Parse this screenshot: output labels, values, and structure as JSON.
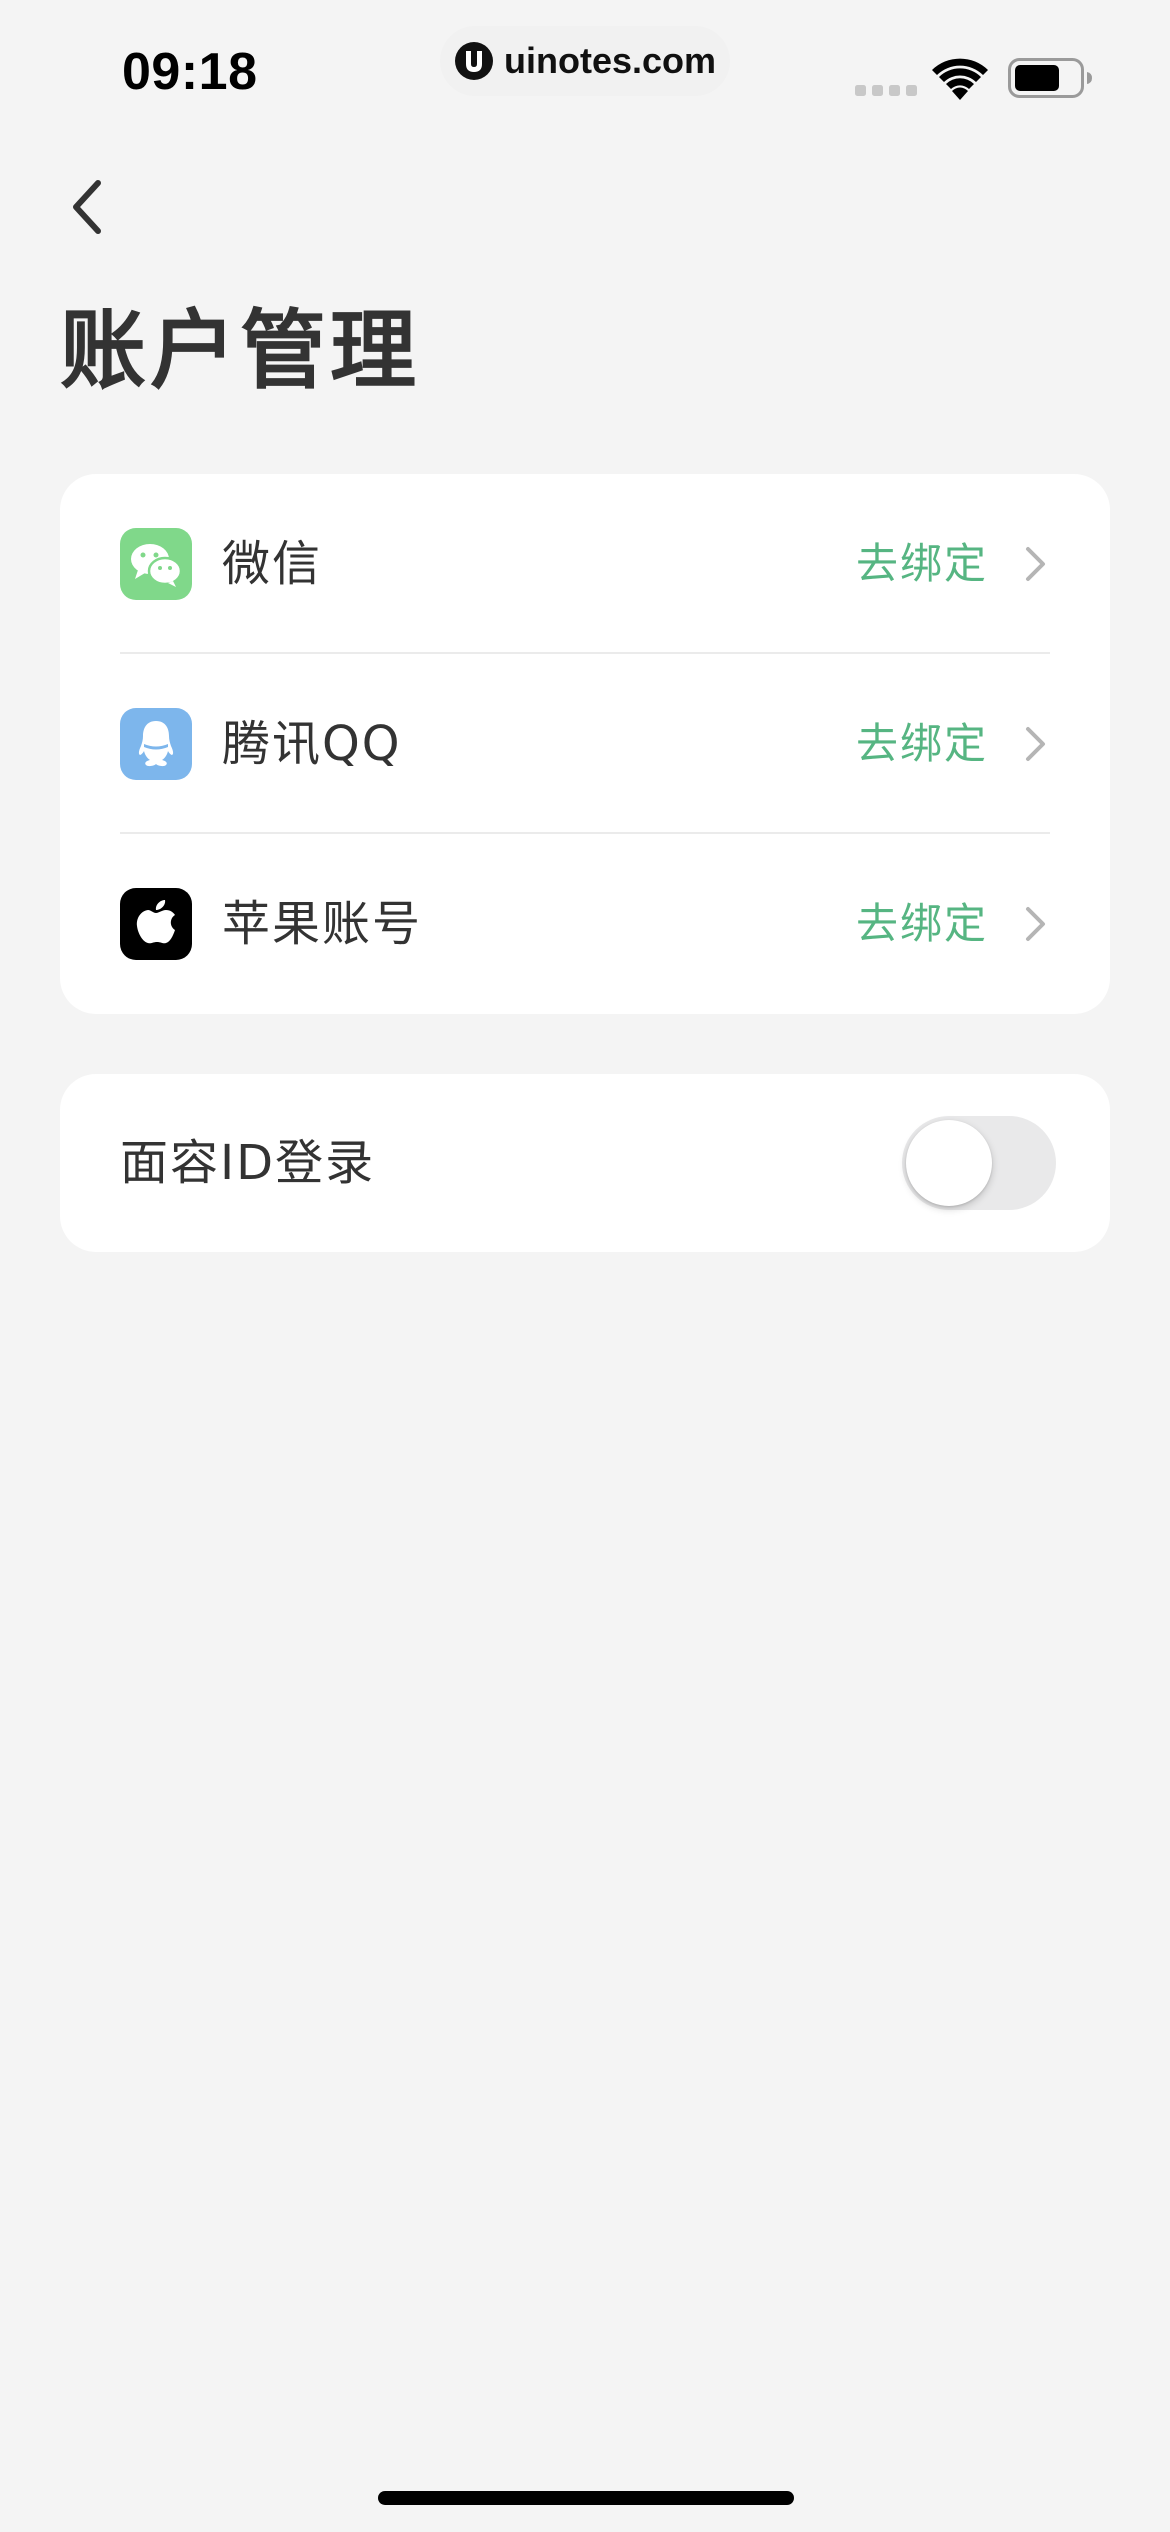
{
  "status_bar": {
    "time": "09:18",
    "watermark": "uinotes.com",
    "signal_icon": "cellular-signal-icon",
    "wifi_icon": "wifi-icon",
    "battery_icon": "battery-icon"
  },
  "header": {
    "back_icon": "chevron-left-icon",
    "title": "账户管理"
  },
  "accounts": [
    {
      "name": "微信",
      "icon": "wechat-icon",
      "icon_color": "#80d88a",
      "action": "去绑定"
    },
    {
      "name": "腾讯QQ",
      "icon": "qq-icon",
      "icon_color": "#7db6ec",
      "action": "去绑定"
    },
    {
      "name": "苹果账号",
      "icon": "apple-icon",
      "icon_color": "#000000",
      "action": "去绑定"
    }
  ],
  "face_id": {
    "label": "面容ID登录",
    "enabled": false
  },
  "colors": {
    "background": "#f4f4f4",
    "card": "#ffffff",
    "accent_green": "#56b582",
    "text": "#333333"
  }
}
